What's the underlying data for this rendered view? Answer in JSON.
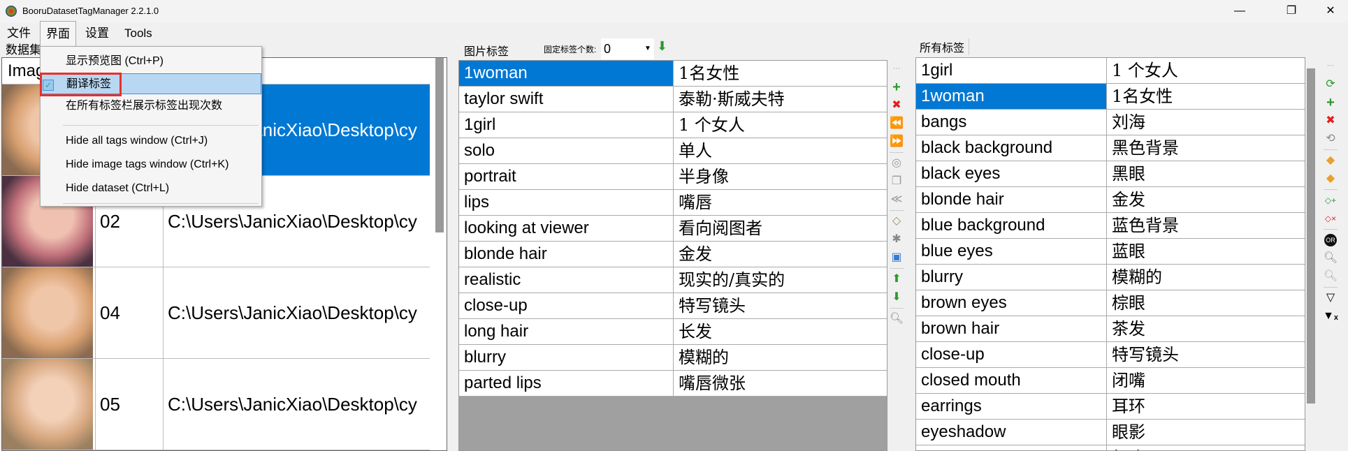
{
  "window": {
    "title": "BooruDatasetTagManager 2.2.1.0",
    "controls": [
      "—",
      "❐",
      "✕"
    ]
  },
  "menubar": [
    "文件",
    "界面",
    "设置",
    "Tools"
  ],
  "dropdown": {
    "items": [
      "显示预览图 (Ctrl+P)",
      "翻译标签",
      "在所有标签栏展示标签出现次数",
      "Hide all tags window (Ctrl+J)",
      "Hide image tags window (Ctrl+K)",
      "Hide dataset (Ctrl+L)"
    ],
    "checked": "翻译标签"
  },
  "dataset": {
    "label": "数据集",
    "header": "Image",
    "rows": [
      {
        "name": "",
        "path": "C:\\Users\\JanicXiao\\Desktop\\cy",
        "selected": true
      },
      {
        "name": "02",
        "path": "C:\\Users\\JanicXiao\\Desktop\\cy"
      },
      {
        "name": "04",
        "path": "C:\\Users\\JanicXiao\\Desktop\\cy"
      },
      {
        "name": "05",
        "path": "C:\\Users\\JanicXiao\\Desktop\\cy"
      }
    ]
  },
  "image_tags": {
    "label": "图片标签",
    "fixed_label": "固定标签个数:",
    "fixed_value": "0",
    "rows": [
      [
        "1woman",
        "1名女性"
      ],
      [
        "taylor swift",
        "泰勒·斯威夫特"
      ],
      [
        "1girl",
        "1 个女人"
      ],
      [
        "solo",
        "单人"
      ],
      [
        "portrait",
        "半身像"
      ],
      [
        "lips",
        "嘴唇"
      ],
      [
        "looking at viewer",
        "看向阅图者"
      ],
      [
        "blonde hair",
        "金发"
      ],
      [
        "realistic",
        "现实的/真实的"
      ],
      [
        "close-up",
        "特写镜头"
      ],
      [
        "long hair",
        "长发"
      ],
      [
        "blurry",
        "模糊的"
      ],
      [
        "parted lips",
        "嘴唇微张"
      ]
    ]
  },
  "all_tags": {
    "label": "所有标签",
    "rows": [
      [
        "1girl",
        "1 个女人"
      ],
      [
        "1woman",
        "1名女性"
      ],
      [
        "bangs",
        "刘海"
      ],
      [
        "black background",
        "黑色背景"
      ],
      [
        "black eyes",
        "黑眼"
      ],
      [
        "blonde hair",
        "金发"
      ],
      [
        "blue background",
        "蓝色背景"
      ],
      [
        "blue eyes",
        "蓝眼"
      ],
      [
        "blurry",
        "模糊的"
      ],
      [
        "brown eyes",
        "棕眼"
      ],
      [
        "brown hair",
        "茶发"
      ],
      [
        "close-up",
        "特写镜头"
      ],
      [
        "closed mouth",
        "闭嘴"
      ],
      [
        "earrings",
        "耳环"
      ],
      [
        "eyeshadow",
        "眼影"
      ],
      [
        "forehead",
        "额头"
      ]
    ],
    "selected_index": 1
  },
  "colors": {
    "selection": "#0078d4",
    "highlight_box": "#e8302a",
    "menu_highlight": "#b8d7f2"
  }
}
